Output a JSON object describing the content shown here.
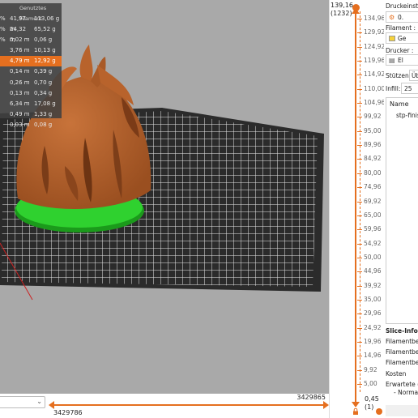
{
  "legend": {
    "header": "Genutztes Filament",
    "rows": [
      {
        "pct": "%",
        "length": "41,97 m",
        "weight": "113,06 g",
        "selected": false
      },
      {
        "pct": "%",
        "length": "24,32 m",
        "weight": "65,52 g",
        "selected": false
      },
      {
        "pct": "%",
        "length": "0,02 m",
        "weight": "0,06 g",
        "selected": false
      },
      {
        "pct": "",
        "length": "3,76 m",
        "weight": "10,13 g",
        "selected": false
      },
      {
        "pct": "",
        "length": "4,79 m",
        "weight": "12,92 g",
        "selected": true
      },
      {
        "pct": "",
        "length": "0,14 m",
        "weight": "0,39 g",
        "selected": false
      },
      {
        "pct": "",
        "length": "0,26 m",
        "weight": "0,70 g",
        "selected": false
      },
      {
        "pct": "",
        "length": "0,13 m",
        "weight": "0,34 g",
        "selected": false
      },
      {
        "pct": "",
        "length": "6,34 m",
        "weight": "17,08 g",
        "selected": false
      },
      {
        "pct": "",
        "length": "0,49 m",
        "weight": "1,33 g",
        "selected": false
      },
      {
        "pct": "",
        "length": "0,03 m",
        "weight": "0,08 g",
        "selected": false
      }
    ]
  },
  "horizontal_slider": {
    "right_value": "3429865",
    "left_value": "3429786"
  },
  "vertical_slider": {
    "top_value": "139,16",
    "top_layer": "(1232)",
    "bottom_value": "0,45",
    "bottom_layer": "(1)",
    "ticks": [
      "134,96",
      "129,92",
      "124,92",
      "119,96",
      "114,92",
      "110,00",
      "104,96",
      "99,92",
      "95,00",
      "89,96",
      "84,92",
      "80,00",
      "74,96",
      "69,92",
      "65,00",
      "59,96",
      "54,92",
      "50,00",
      "44,96",
      "39,92",
      "35,00",
      "29,96",
      "24,92",
      "19,96",
      "14,96",
      "9,92",
      "5,00"
    ]
  },
  "panel": {
    "print_settings_label": "Druckeinste",
    "print_settings_value": "0.",
    "filament_label": "Filament :",
    "filament_value": "Ge",
    "printer_label": "Drucker :",
    "printer_value": "El",
    "supports_label": "Stützen:",
    "supports_value": "Üb",
    "infill_label": "Infill:",
    "infill_value": "25",
    "object_list_header": "Name",
    "object_name": "stp-finis",
    "slice_info": {
      "title": "Slice-Info",
      "rows": [
        "Filamentbe",
        "Filamentbe",
        "Filamentbe",
        "Kosten",
        "Erwartete ("
      ],
      "sub": "- Normal"
    }
  },
  "colors": {
    "accent": "#e56f1f",
    "model": "#b8632c",
    "skirt": "#2fd12f",
    "bed": "#2a2a2a",
    "background": "#a9a9a9"
  }
}
